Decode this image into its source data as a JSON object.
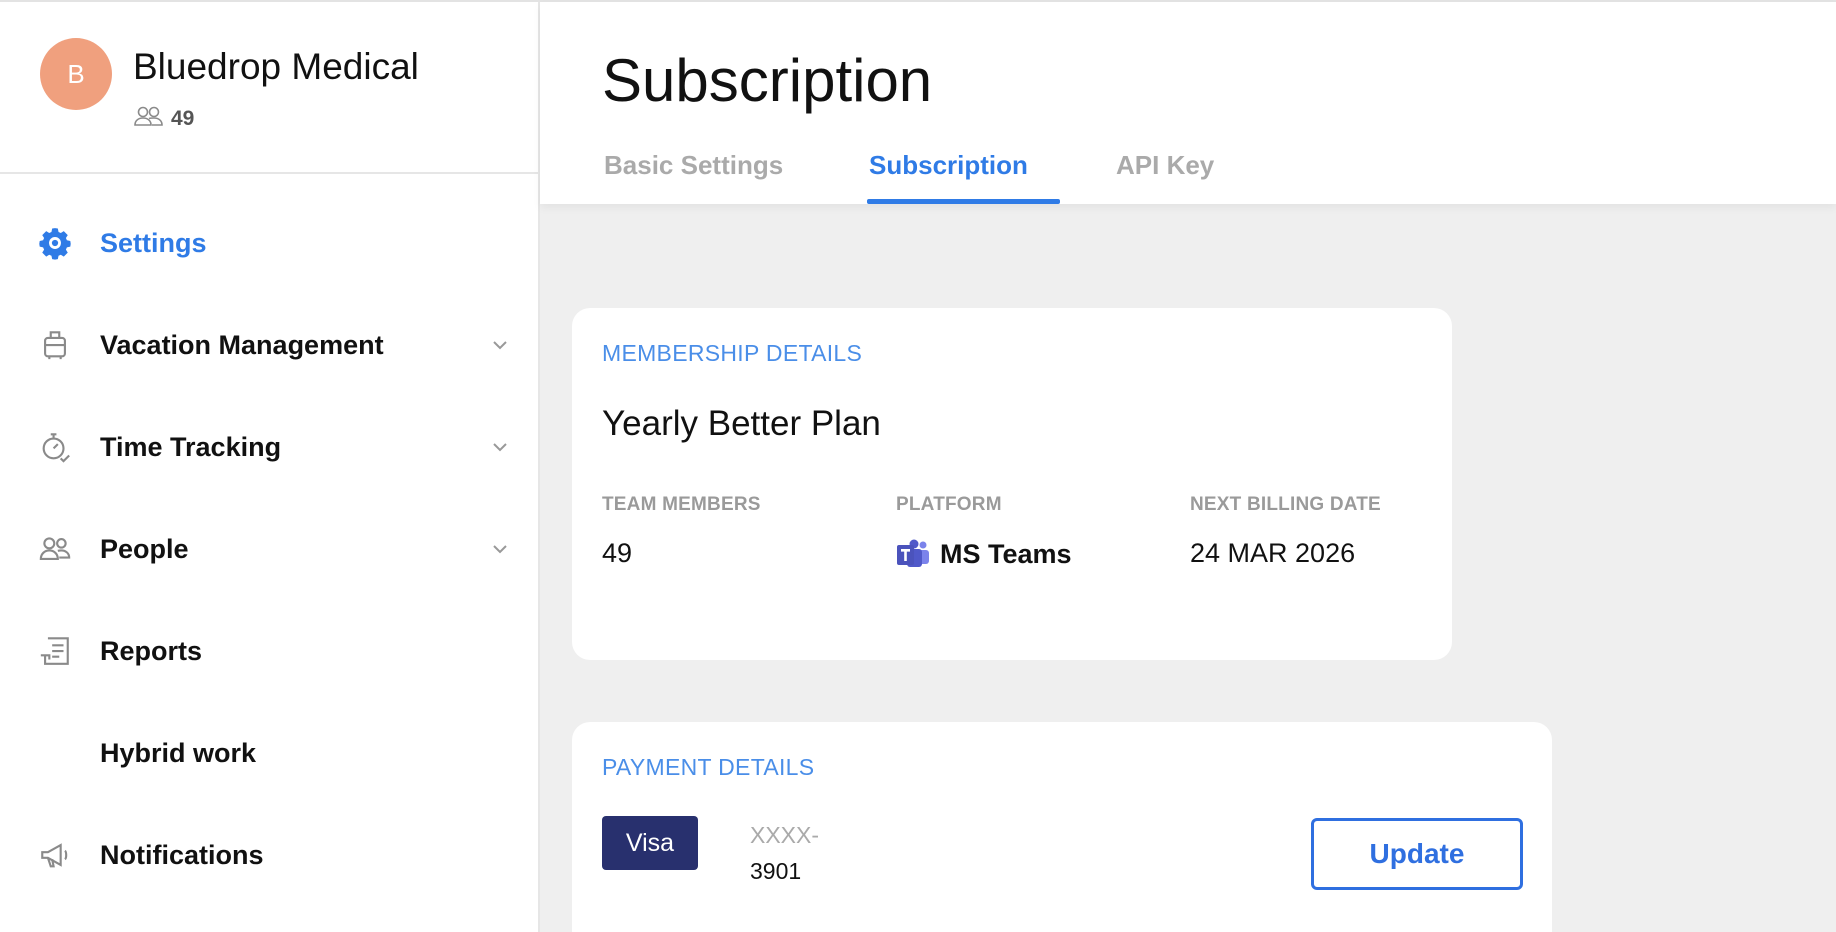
{
  "org": {
    "avatar_letter": "B",
    "name": "Bluedrop Medical",
    "member_count": "49",
    "avatar_color": "#f0a07e"
  },
  "sidebar": {
    "items": [
      {
        "label": "Settings",
        "icon": "gear-icon",
        "active": true,
        "expandable": false
      },
      {
        "label": "Vacation Management",
        "icon": "luggage-icon",
        "active": false,
        "expandable": true
      },
      {
        "label": "Time Tracking",
        "icon": "stopwatch-icon",
        "active": false,
        "expandable": true
      },
      {
        "label": "People",
        "icon": "people-icon",
        "active": false,
        "expandable": true
      },
      {
        "label": "Reports",
        "icon": "report-icon",
        "active": false,
        "expandable": false
      },
      {
        "label": "Hybrid work",
        "icon": "",
        "active": false,
        "expandable": false
      },
      {
        "label": "Notifications",
        "icon": "megaphone-icon",
        "active": false,
        "expandable": false
      }
    ]
  },
  "header": {
    "title": "Subscription",
    "tabs": [
      {
        "label": "Basic Settings",
        "active": false
      },
      {
        "label": "Subscription",
        "active": true
      },
      {
        "label": "API Key",
        "active": false
      }
    ]
  },
  "membership": {
    "section_title": "MEMBERSHIP DETAILS",
    "plan_name": "Yearly Better Plan",
    "team_members_label": "TEAM MEMBERS",
    "team_members_value": "49",
    "platform_label": "PLATFORM",
    "platform_value": "MS Teams",
    "platform_icon": "ms-teams-icon",
    "billing_label": "NEXT BILLING DATE",
    "billing_value": "24 MAR 2026"
  },
  "payment": {
    "section_title": "PAYMENT DETAILS",
    "card_brand": "Visa",
    "card_mask": "XXXX-",
    "card_last4": "3901",
    "update_label": "Update"
  },
  "colors": {
    "accent": "#2f7be6",
    "section_title": "#4a8ee8",
    "visa_bg": "#28306e",
    "main_bg": "#efefef"
  }
}
